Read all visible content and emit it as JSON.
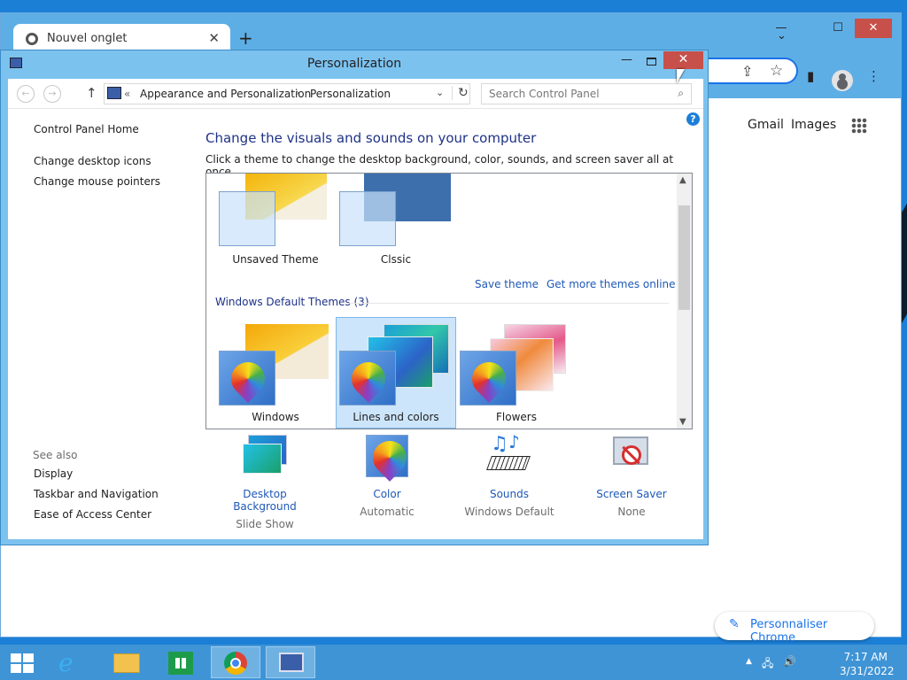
{
  "browser": {
    "tab_title": "Nouvel onglet",
    "tab_close": "✕",
    "new_tab": "+",
    "tab_list_icon": "chevron-down",
    "minimize": "—",
    "maximize": "☐",
    "close": "✕",
    "share_icon": "⇪",
    "bookmark_icon": "☆",
    "sidepanel_icon": "▮",
    "menu_icon": "⋮",
    "gmail": "Gmail",
    "images": "Images",
    "customize_label": "Personnaliser Chrome",
    "customize_icon": "✎"
  },
  "window": {
    "title": "Personalization",
    "minimize": "—",
    "close": "✕"
  },
  "navbar": {
    "back": "←",
    "forward": "→",
    "up": "↑",
    "breadcrumb_prefix": "«",
    "breadcrumb": [
      "Appearance and Personalization",
      "Personalization"
    ],
    "breadcrumb_sep": "›",
    "dropdown": "⌄",
    "refresh": "↻",
    "search_placeholder": "Search Control Panel",
    "search_icon": "⌕",
    "help": "?"
  },
  "sidebar": {
    "items": [
      "Control Panel Home",
      "Change desktop icons",
      "Change mouse pointers"
    ],
    "see_also_title": "See also",
    "see_also": [
      "Display",
      "Taskbar and Navigation",
      "Ease of Access Center"
    ]
  },
  "main": {
    "heading": "Change the visuals and sounds on your computer",
    "description": "Click a theme to change the desktop background, color, sounds, and screen saver all at once.",
    "my_themes": [
      "Unsaved Theme",
      "Clssic"
    ],
    "save_theme": "Save theme",
    "get_more": "Get more themes online",
    "default_group": "Windows Default Themes (3)",
    "default_themes": [
      "Windows",
      "Lines and colors",
      "Flowers"
    ],
    "selected_theme": "Lines and colors",
    "scroll_up": "▲",
    "scroll_down": "▼"
  },
  "options": [
    {
      "label": "Desktop Background",
      "sub": "Slide Show",
      "icon": "desktop-background-icon"
    },
    {
      "label": "Color",
      "sub": "Automatic",
      "icon": "color-icon"
    },
    {
      "label": "Sounds",
      "sub": "Windows Default",
      "icon": "sounds-icon"
    },
    {
      "label": "Screen Saver",
      "sub": "None",
      "icon": "screen-saver-icon"
    }
  ],
  "taskbar": {
    "time": "7:17 AM",
    "date": "3/31/2022",
    "tray_arrow": "▲",
    "volume": "🔊",
    "network": "🖧"
  },
  "colors": {
    "desktop": "#1c7fd6",
    "taskbar": "#3f94d6",
    "close_red": "#c7504a",
    "link": "#1e58b7",
    "heading": "#1e3287"
  }
}
